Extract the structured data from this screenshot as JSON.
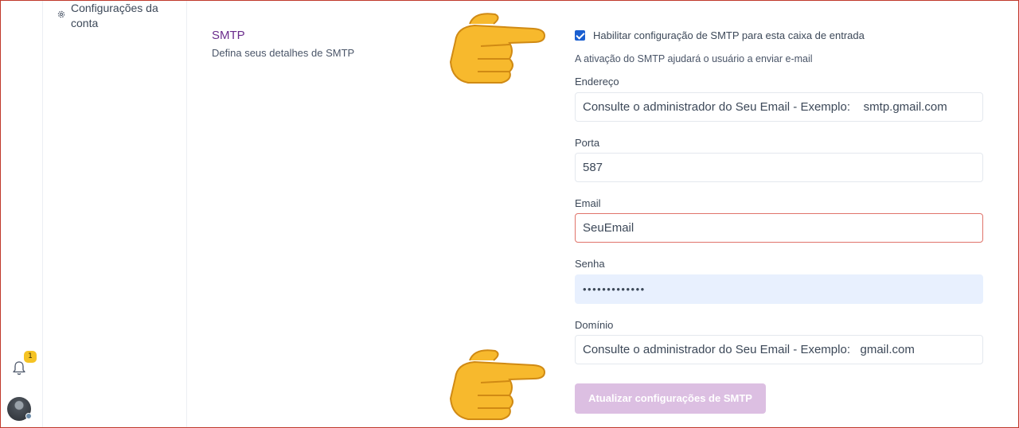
{
  "sidebar": {
    "account_settings": {
      "icon": "gear-icon",
      "label_line1": "Configurações da",
      "label_line2": "conta"
    }
  },
  "rail": {
    "notification_icon": "bell-icon",
    "notification_count": "1",
    "avatar_icon": "user-avatar"
  },
  "smtp": {
    "title": "SMTP",
    "description": "Defina seus detalhes de SMTP",
    "enable_label": "Habilitar configuração de SMTP para esta caixa de entrada",
    "enable_checked": true,
    "enable_help": "A ativação do SMTP ajudará o usuário a enviar e-mail",
    "address": {
      "label": "Endereço",
      "value": "Consulte o administrador do Seu Email - Exemplo:    smtp.gmail.com"
    },
    "port": {
      "label": "Porta",
      "value": "587"
    },
    "email": {
      "label": "Email",
      "value": "SeuEmail"
    },
    "password": {
      "label": "Senha",
      "value": "•••••••••••••"
    },
    "domain": {
      "label": "Domínio",
      "value": "Consulte o administrador do Seu Email - Exemplo:   gmail.com"
    },
    "submit_label": "Atualizar configurações de SMTP"
  },
  "overlays": {
    "pointer_icon": "pointing-hand-emoji"
  },
  "colors": {
    "accent": "#6a2c8c",
    "button": "#dcbfe2",
    "checkbox": "#1a5fd0",
    "error_border": "#e0736a",
    "badge": "#f5c324"
  }
}
